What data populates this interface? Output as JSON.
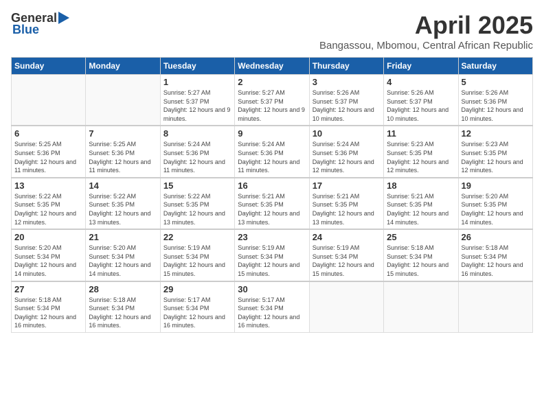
{
  "logo": {
    "general": "General",
    "blue": "Blue"
  },
  "title": "April 2025",
  "subtitle": "Bangassou, Mbomou, Central African Republic",
  "days_of_week": [
    "Sunday",
    "Monday",
    "Tuesday",
    "Wednesday",
    "Thursday",
    "Friday",
    "Saturday"
  ],
  "weeks": [
    [
      {
        "day": "",
        "info": ""
      },
      {
        "day": "",
        "info": ""
      },
      {
        "day": "1",
        "info": "Sunrise: 5:27 AM\nSunset: 5:37 PM\nDaylight: 12 hours and 9 minutes."
      },
      {
        "day": "2",
        "info": "Sunrise: 5:27 AM\nSunset: 5:37 PM\nDaylight: 12 hours and 9 minutes."
      },
      {
        "day": "3",
        "info": "Sunrise: 5:26 AM\nSunset: 5:37 PM\nDaylight: 12 hours and 10 minutes."
      },
      {
        "day": "4",
        "info": "Sunrise: 5:26 AM\nSunset: 5:37 PM\nDaylight: 12 hours and 10 minutes."
      },
      {
        "day": "5",
        "info": "Sunrise: 5:26 AM\nSunset: 5:36 PM\nDaylight: 12 hours and 10 minutes."
      }
    ],
    [
      {
        "day": "6",
        "info": "Sunrise: 5:25 AM\nSunset: 5:36 PM\nDaylight: 12 hours and 11 minutes."
      },
      {
        "day": "7",
        "info": "Sunrise: 5:25 AM\nSunset: 5:36 PM\nDaylight: 12 hours and 11 minutes."
      },
      {
        "day": "8",
        "info": "Sunrise: 5:24 AM\nSunset: 5:36 PM\nDaylight: 12 hours and 11 minutes."
      },
      {
        "day": "9",
        "info": "Sunrise: 5:24 AM\nSunset: 5:36 PM\nDaylight: 12 hours and 11 minutes."
      },
      {
        "day": "10",
        "info": "Sunrise: 5:24 AM\nSunset: 5:36 PM\nDaylight: 12 hours and 12 minutes."
      },
      {
        "day": "11",
        "info": "Sunrise: 5:23 AM\nSunset: 5:35 PM\nDaylight: 12 hours and 12 minutes."
      },
      {
        "day": "12",
        "info": "Sunrise: 5:23 AM\nSunset: 5:35 PM\nDaylight: 12 hours and 12 minutes."
      }
    ],
    [
      {
        "day": "13",
        "info": "Sunrise: 5:22 AM\nSunset: 5:35 PM\nDaylight: 12 hours and 12 minutes."
      },
      {
        "day": "14",
        "info": "Sunrise: 5:22 AM\nSunset: 5:35 PM\nDaylight: 12 hours and 13 minutes."
      },
      {
        "day": "15",
        "info": "Sunrise: 5:22 AM\nSunset: 5:35 PM\nDaylight: 12 hours and 13 minutes."
      },
      {
        "day": "16",
        "info": "Sunrise: 5:21 AM\nSunset: 5:35 PM\nDaylight: 12 hours and 13 minutes."
      },
      {
        "day": "17",
        "info": "Sunrise: 5:21 AM\nSunset: 5:35 PM\nDaylight: 12 hours and 13 minutes."
      },
      {
        "day": "18",
        "info": "Sunrise: 5:21 AM\nSunset: 5:35 PM\nDaylight: 12 hours and 14 minutes."
      },
      {
        "day": "19",
        "info": "Sunrise: 5:20 AM\nSunset: 5:35 PM\nDaylight: 12 hours and 14 minutes."
      }
    ],
    [
      {
        "day": "20",
        "info": "Sunrise: 5:20 AM\nSunset: 5:34 PM\nDaylight: 12 hours and 14 minutes."
      },
      {
        "day": "21",
        "info": "Sunrise: 5:20 AM\nSunset: 5:34 PM\nDaylight: 12 hours and 14 minutes."
      },
      {
        "day": "22",
        "info": "Sunrise: 5:19 AM\nSunset: 5:34 PM\nDaylight: 12 hours and 15 minutes."
      },
      {
        "day": "23",
        "info": "Sunrise: 5:19 AM\nSunset: 5:34 PM\nDaylight: 12 hours and 15 minutes."
      },
      {
        "day": "24",
        "info": "Sunrise: 5:19 AM\nSunset: 5:34 PM\nDaylight: 12 hours and 15 minutes."
      },
      {
        "day": "25",
        "info": "Sunrise: 5:18 AM\nSunset: 5:34 PM\nDaylight: 12 hours and 15 minutes."
      },
      {
        "day": "26",
        "info": "Sunrise: 5:18 AM\nSunset: 5:34 PM\nDaylight: 12 hours and 16 minutes."
      }
    ],
    [
      {
        "day": "27",
        "info": "Sunrise: 5:18 AM\nSunset: 5:34 PM\nDaylight: 12 hours and 16 minutes."
      },
      {
        "day": "28",
        "info": "Sunrise: 5:18 AM\nSunset: 5:34 PM\nDaylight: 12 hours and 16 minutes."
      },
      {
        "day": "29",
        "info": "Sunrise: 5:17 AM\nSunset: 5:34 PM\nDaylight: 12 hours and 16 minutes."
      },
      {
        "day": "30",
        "info": "Sunrise: 5:17 AM\nSunset: 5:34 PM\nDaylight: 12 hours and 16 minutes."
      },
      {
        "day": "",
        "info": ""
      },
      {
        "day": "",
        "info": ""
      },
      {
        "day": "",
        "info": ""
      }
    ]
  ]
}
